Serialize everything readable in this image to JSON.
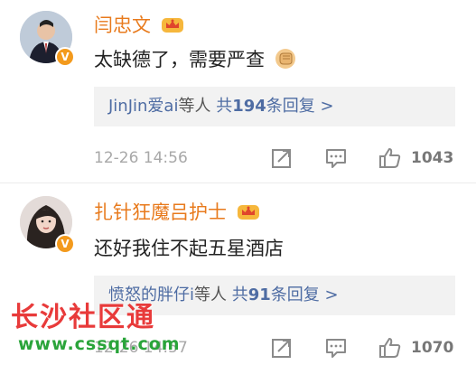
{
  "comments": [
    {
      "username": "闫忠文",
      "text": "太缺德了，需要严查",
      "replies": {
        "users": "JinJin爱ai",
        "suffix": "等人",
        "count_prefix": "共",
        "count": "194",
        "count_suffix": "条回复 >"
      },
      "time": "12-26 14:56",
      "likes": "1043"
    },
    {
      "username": "扎针狂魔吕护士",
      "text": "还好我住不起五星酒店",
      "replies": {
        "users": "愤怒的胖仔i",
        "suffix": "等人",
        "count_prefix": "共",
        "count": "91",
        "count_suffix": "条回复 >"
      },
      "time": "12-26 14:57",
      "likes": "1070"
    }
  ],
  "watermark": {
    "title": "长沙社区通",
    "url": "www.cssqt.com"
  },
  "icons": {
    "verified": "verified-v-badge",
    "crown": "vip-crown-icon",
    "emoji": "fist-emoji-icon",
    "share": "share-icon",
    "comment": "comment-icon",
    "like": "thumbs-up-icon"
  },
  "colors": {
    "username": "#e87a1c",
    "link": "#4e6ca3",
    "muted": "#a8a8a8",
    "badge": "#f39a1d",
    "watermark_red": "#e83a3a",
    "watermark_green": "#2aa43a"
  }
}
